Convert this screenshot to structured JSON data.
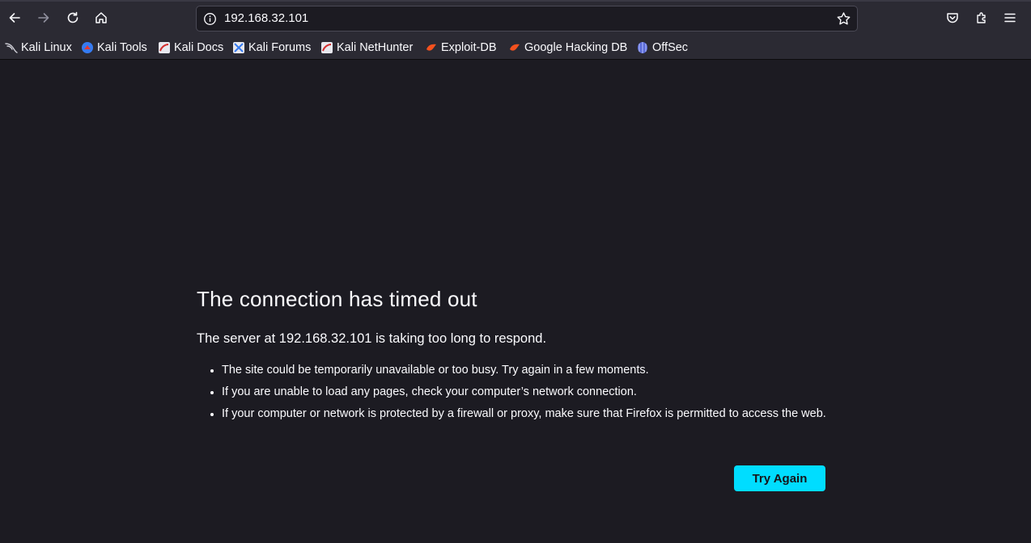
{
  "browser": {
    "url": "192.168.32.101",
    "toolbar_icons": [
      "back-icon",
      "forward-icon",
      "reload-icon",
      "home-icon",
      "site-info-icon",
      "bookmark-star-icon",
      "pocket-icon",
      "extensions-icon",
      "menu-icon"
    ]
  },
  "bookmarks": [
    {
      "label": "Kali Linux",
      "icon": "kali-dragon-icon"
    },
    {
      "label": "Kali Tools",
      "icon": "kali-tools-icon"
    },
    {
      "label": "Kali Docs",
      "icon": "kali-docs-icon"
    },
    {
      "label": "Kali Forums",
      "icon": "kali-forums-icon"
    },
    {
      "label": "Kali NetHunter",
      "icon": "kali-nethunter-icon"
    },
    {
      "label": "Exploit-DB",
      "icon": "exploit-db-icon"
    },
    {
      "label": "Google Hacking DB",
      "icon": "google-hacking-db-icon"
    },
    {
      "label": "OffSec",
      "icon": "offsec-icon"
    }
  ],
  "error": {
    "title": "The connection has timed out",
    "subtitle": "The server at 192.168.32.101 is taking too long to respond.",
    "bullets": [
      "The site could be temporarily unavailable or too busy. Try again in a few moments.",
      "If you are unable to load any pages, check your computer’s network connection.",
      "If your computer or network is protected by a firewall or proxy, make sure that Firefox is permitted to access the web."
    ],
    "button_label": "Try Again"
  },
  "colors": {
    "page_bg": "#1c1b22",
    "toolbar_bg": "#2b2a33",
    "accent_button": "#00ddff"
  }
}
